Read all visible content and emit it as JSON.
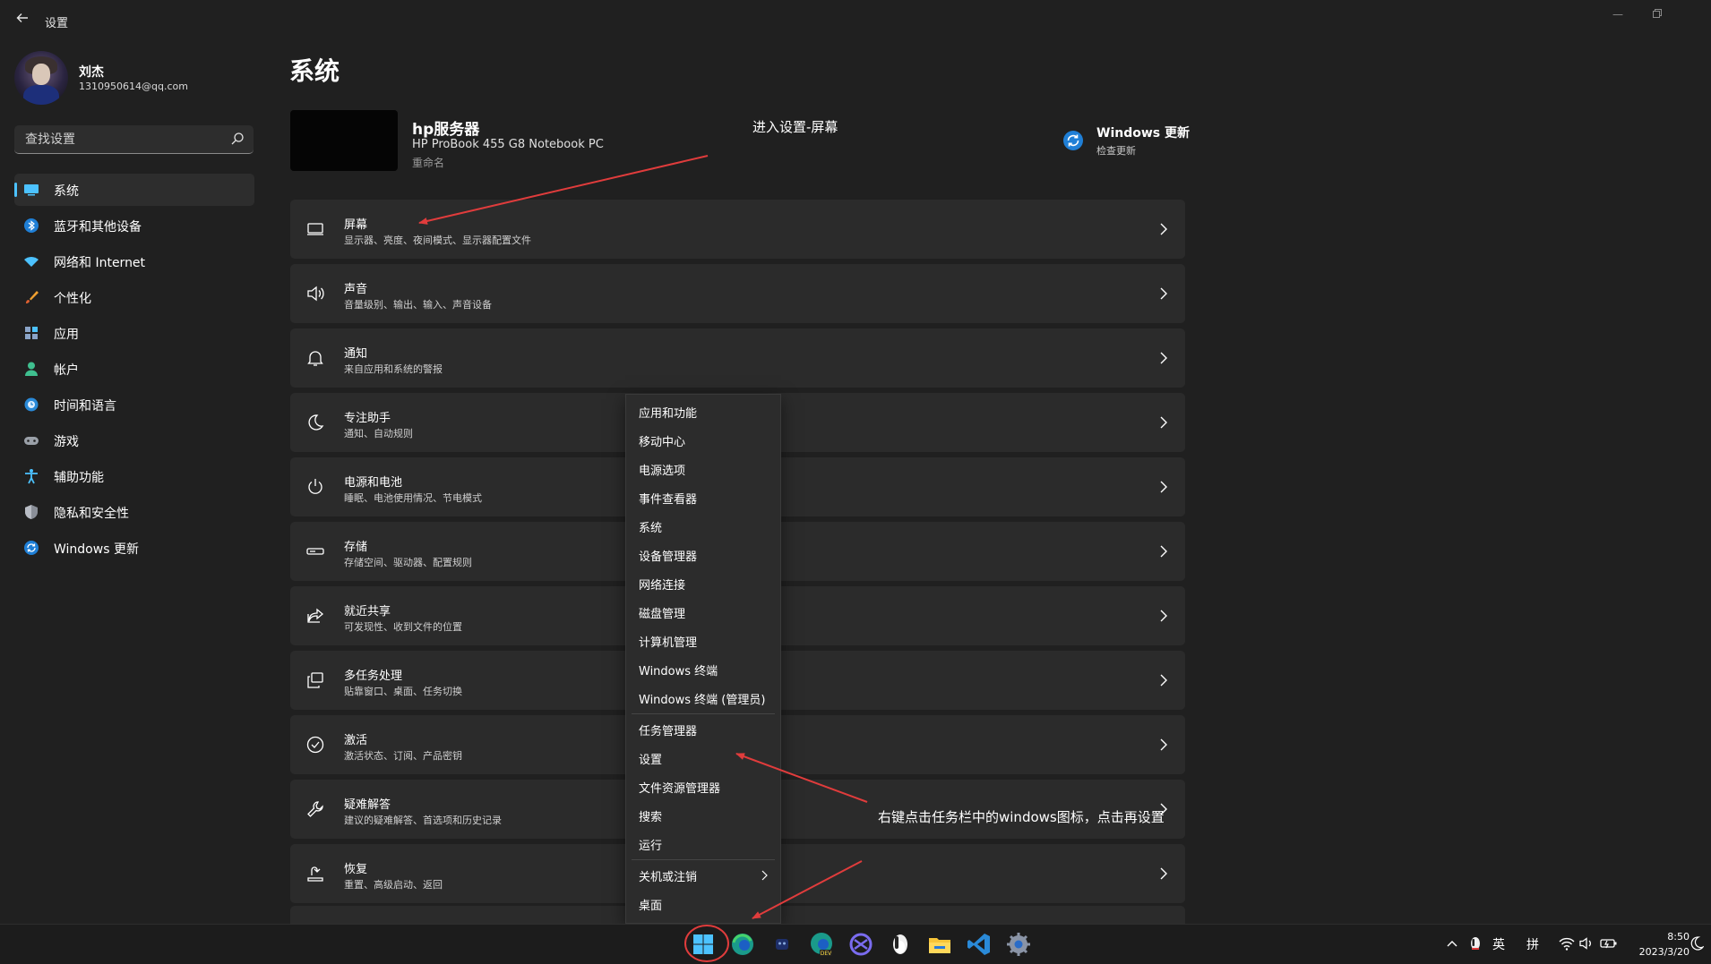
{
  "window": {
    "app_title": "设置",
    "back_icon": "back-arrow-icon",
    "controls": [
      "minimize-icon",
      "restore-icon"
    ]
  },
  "user": {
    "name": "刘杰",
    "email": "1310950614@qq.com"
  },
  "search": {
    "placeholder": "查找设置",
    "icon": "search-icon"
  },
  "sidebar": {
    "items": [
      {
        "label": "系统",
        "icon": "system-icon",
        "active": true
      },
      {
        "label": "蓝牙和其他设备",
        "icon": "bluetooth-icon"
      },
      {
        "label": "网络和 Internet",
        "icon": "network-icon"
      },
      {
        "label": "个性化",
        "icon": "brush-icon"
      },
      {
        "label": "应用",
        "icon": "apps-icon"
      },
      {
        "label": "帐户",
        "icon": "account-icon"
      },
      {
        "label": "时间和语言",
        "icon": "globe-clock-icon"
      },
      {
        "label": "游戏",
        "icon": "gamepad-icon"
      },
      {
        "label": "辅助功能",
        "icon": "accessibility-icon"
      },
      {
        "label": "隐私和安全性",
        "icon": "shield-icon"
      },
      {
        "label": "Windows 更新",
        "icon": "update-icon"
      }
    ]
  },
  "main": {
    "title": "系统",
    "device": {
      "name": "hp服务器",
      "model": "HP ProBook 455 G8 Notebook PC",
      "rename": "重命名"
    },
    "update": {
      "title": "Windows 更新",
      "subtitle": "检查更新"
    },
    "settings": [
      {
        "title": "屏幕",
        "subtitle": "显示器、亮度、夜间模式、显示器配置文件",
        "icon": "monitor-icon"
      },
      {
        "title": "声音",
        "subtitle": "音量级别、输出、输入、声音设备",
        "icon": "speaker-icon"
      },
      {
        "title": "通知",
        "subtitle": "来自应用和系统的警报",
        "icon": "bell-icon"
      },
      {
        "title": "专注助手",
        "subtitle": "通知、自动规则",
        "icon": "moon-icon"
      },
      {
        "title": "电源和电池",
        "subtitle": "睡眠、电池使用情况、节电模式",
        "icon": "power-icon"
      },
      {
        "title": "存储",
        "subtitle": "存储空间、驱动器、配置规则",
        "icon": "storage-icon"
      },
      {
        "title": "就近共享",
        "subtitle": "可发现性、收到文件的位置",
        "icon": "share-icon"
      },
      {
        "title": "多任务处理",
        "subtitle": "贴靠窗口、桌面、任务切换",
        "icon": "multitask-icon"
      },
      {
        "title": "激活",
        "subtitle": "激活状态、订阅、产品密钥",
        "icon": "check-circle-icon"
      },
      {
        "title": "疑难解答",
        "subtitle": "建议的疑难解答、首选项和历史记录",
        "icon": "wrench-icon"
      },
      {
        "title": "恢复",
        "subtitle": "重置、高级启动、返回",
        "icon": "recovery-icon"
      }
    ]
  },
  "annotations": {
    "top": "进入设置-屏幕",
    "bottom": "右键点击任务栏中的windows图标，点击再设置",
    "arrow_color": "#e03c3c"
  },
  "context_menu": {
    "groups": [
      [
        "应用和功能",
        "移动中心",
        "电源选项",
        "事件查看器",
        "系统",
        "设备管理器",
        "网络连接",
        "磁盘管理",
        "计算机管理",
        "Windows 终端",
        "Windows 终端 (管理员)"
      ],
      [
        "任务管理器",
        "设置",
        "文件资源管理器",
        "搜索",
        "运行"
      ],
      [
        "关机或注销",
        "桌面"
      ]
    ],
    "submenu_item": "关机或注销"
  },
  "taskbar": {
    "apps": [
      "start-icon",
      "edge-icon",
      "mascot-icon",
      "edge-dev-icon",
      "network-app-icon",
      "qq-penguin-icon",
      "file-explorer-icon",
      "vscode-icon",
      "settings-gear-icon"
    ],
    "tray": {
      "lang": "英",
      "ime": "拼",
      "time": "8:50",
      "date": "2023/3/20"
    }
  },
  "colors": {
    "accent": "#4cc2ff",
    "background": "#202020",
    "card": "#2b2b2b",
    "annotation_red": "#e03c3c"
  }
}
